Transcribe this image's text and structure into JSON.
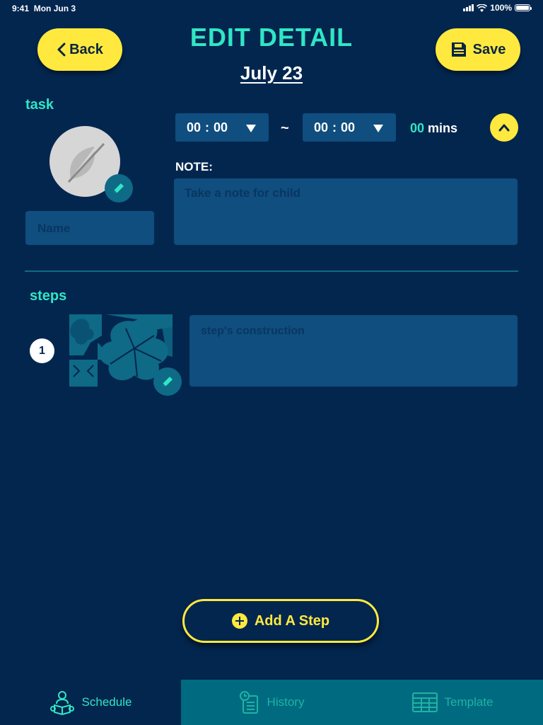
{
  "status": {
    "time": "9:41",
    "date": "Mon Jun 3",
    "battery": "100%"
  },
  "header": {
    "back_label": "Back",
    "title": "EDIT DETAIL",
    "save_label": "Save",
    "date": "July 23"
  },
  "task": {
    "section_label": "task",
    "name_placeholder": "Name",
    "start_time": {
      "hours": "00",
      "minutes": "00"
    },
    "end_time": {
      "hours": "00",
      "minutes": "00"
    },
    "separator": "~",
    "colon": ":",
    "duration_value": "00",
    "duration_unit": "mins",
    "note_label": "NOTE:",
    "note_placeholder": "Take a note for child"
  },
  "steps": {
    "section_label": "steps",
    "items": [
      {
        "number": "1",
        "placeholder": "step's construction"
      }
    ],
    "add_label": "Add A Step"
  },
  "tabs": [
    {
      "label": "Schedule",
      "icon": "reader-icon",
      "active": true
    },
    {
      "label": "History",
      "icon": "clock-document-icon",
      "active": false
    },
    {
      "label": "Template",
      "icon": "table-template-icon",
      "active": false
    }
  ],
  "colors": {
    "background": "#03264f",
    "accent_yellow": "#ffe93f",
    "accent_teal": "#30e6c4",
    "field_bg": "#0f4e7f",
    "tab_inactive_bg": "#006b80"
  }
}
